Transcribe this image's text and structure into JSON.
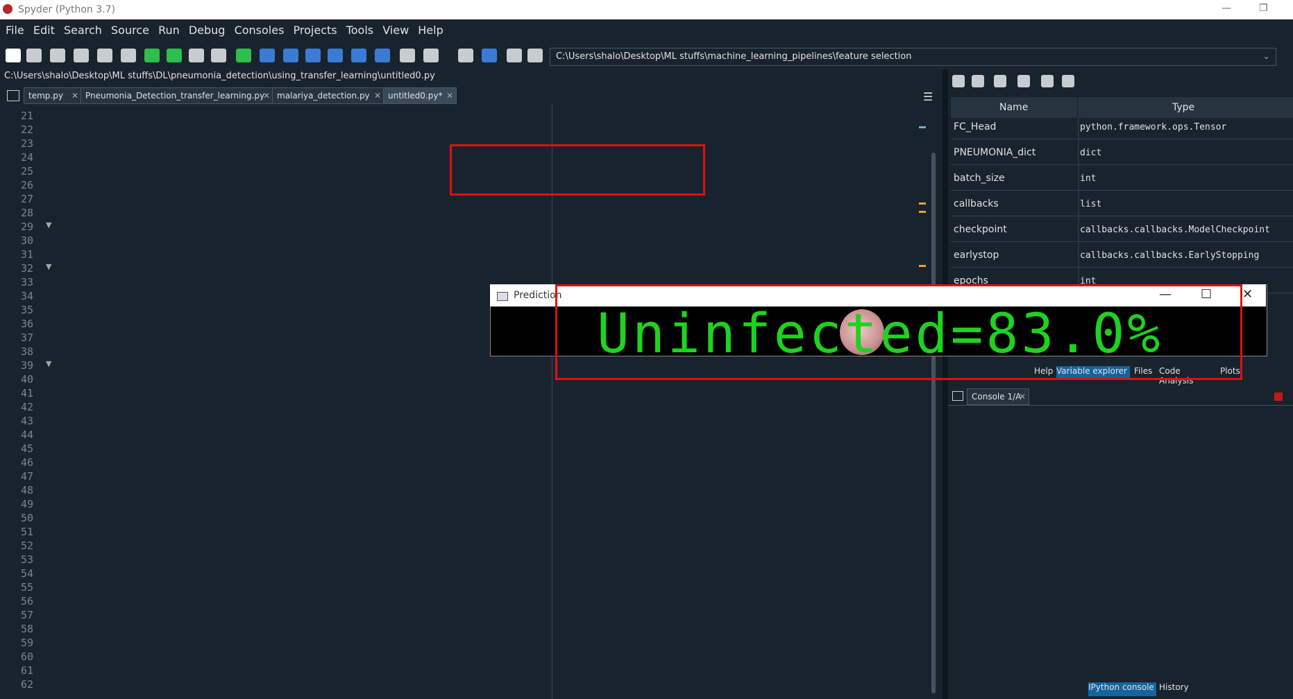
{
  "window": {
    "title": "Spyder (Python 3.7)"
  },
  "menu": [
    "File",
    "Edit",
    "Search",
    "Source",
    "Run",
    "Debug",
    "Consoles",
    "Projects",
    "Tools",
    "View",
    "Help"
  ],
  "toolbar": {
    "path": "C:\\Users\\shalo\\Desktop\\ML stuffs\\machine_learning_pipelines\\feature selection"
  },
  "editor": {
    "filepath": "C:\\Users\\shalo\\Desktop\\ML stuffs\\DL\\pneumonia_detection\\using_transfer_learning\\untitled0.py",
    "tabs": [
      {
        "label": "temp.py"
      },
      {
        "label": "Pneumonia_Detection_transfer_learning.py"
      },
      {
        "label": "malariya_detection.py"
      },
      {
        "label": "untitled0.py*"
      }
    ],
    "line_numbers": [
      "21",
      "22",
      "23",
      "24",
      "25",
      "26",
      "27",
      "28",
      "29",
      "30",
      "31",
      "32",
      "33",
      "34",
      "35",
      "36",
      "37",
      "38",
      "39",
      "40",
      "41",
      "42",
      "43",
      "44",
      "45",
      "46",
      "47",
      "48",
      "49",
      "50",
      "51",
      "52",
      "53",
      "54",
      "55",
      "56",
      "57",
      "58",
      "59",
      "60",
      "61",
      "62"
    ]
  },
  "variables": {
    "headers": {
      "name": "Name",
      "type": "Type"
    },
    "rows": [
      {
        "name": "FC_Head",
        "type": "python.framework.ops.Tensor"
      },
      {
        "name": "PNEUMONIA_dict",
        "type": "dict"
      },
      {
        "name": "batch_size",
        "type": "int"
      },
      {
        "name": "callbacks",
        "type": "list"
      },
      {
        "name": "checkpoint",
        "type": "callbacks.callbacks.ModelCheckpoint"
      },
      {
        "name": "earlystop",
        "type": "callbacks.callbacks.EarlyStopping"
      },
      {
        "name": "epochs",
        "type": "int"
      }
    ]
  },
  "pane_tabs": [
    "Help",
    "Variable explorer",
    "Files",
    "Code Analysis",
    "Plots"
  ],
  "console": {
    "tab": "Console 1/A"
  },
  "bottom_tabs": [
    "IPython console",
    "History"
  ],
  "prediction_window": {
    "title": "Prediction",
    "text": "Uninfected=83.0%"
  }
}
